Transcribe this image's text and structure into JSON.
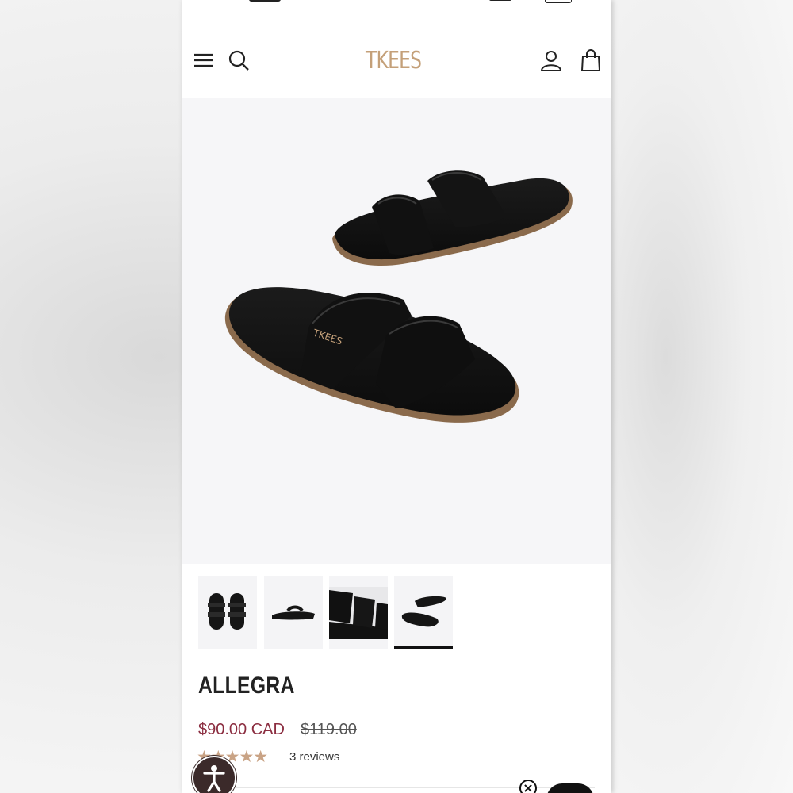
{
  "brand": {
    "logo_text": "TKEES",
    "logo_color": "#c4a079"
  },
  "header": {
    "menu_icon": "hamburger-menu-icon",
    "search_icon": "search-icon",
    "account_icon": "user-account-icon",
    "cart_icon": "shopping-bag-icon"
  },
  "product": {
    "name": "ALLEGRA",
    "price": "$90.00 CAD",
    "compare_at_price": "$119.00",
    "rating": 5,
    "reviews_label": "3 reviews",
    "price_color": "#8b2d40",
    "star_color": "#c9a385"
  },
  "gallery": {
    "thumbnails": [
      {
        "view": "top-view-pair",
        "selected": false
      },
      {
        "view": "side-view",
        "selected": false
      },
      {
        "view": "close-up-straps",
        "selected": false
      },
      {
        "view": "angled-pair",
        "selected": true
      }
    ]
  },
  "widgets": {
    "accessibility_icon": "accessibility-person-icon",
    "chat_close_icon": "close-icon"
  }
}
